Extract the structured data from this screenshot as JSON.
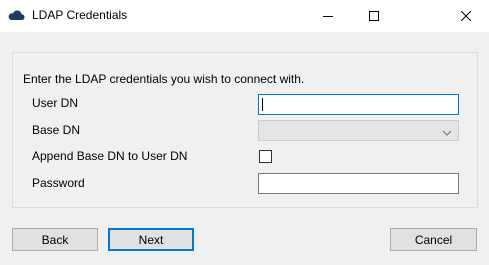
{
  "window": {
    "title": "LDAP Credentials",
    "icon": "cloud-icon",
    "controls": {
      "minimize": "minimize-icon",
      "maximize": "maximize-icon",
      "close": "close-icon"
    }
  },
  "form": {
    "instruction": "Enter the LDAP credentials you wish to connect with.",
    "user_dn_label": "User DN",
    "user_dn_value": "",
    "base_dn_label": "Base DN",
    "base_dn_value": "",
    "append_label": "Append Base DN to User DN",
    "append_checked": false,
    "password_label": "Password",
    "password_value": ""
  },
  "buttons": {
    "back": "Back",
    "next": "Next",
    "cancel": "Cancel"
  },
  "colors": {
    "focus_border": "#0078d7",
    "icon_navy": "#1f3864"
  }
}
